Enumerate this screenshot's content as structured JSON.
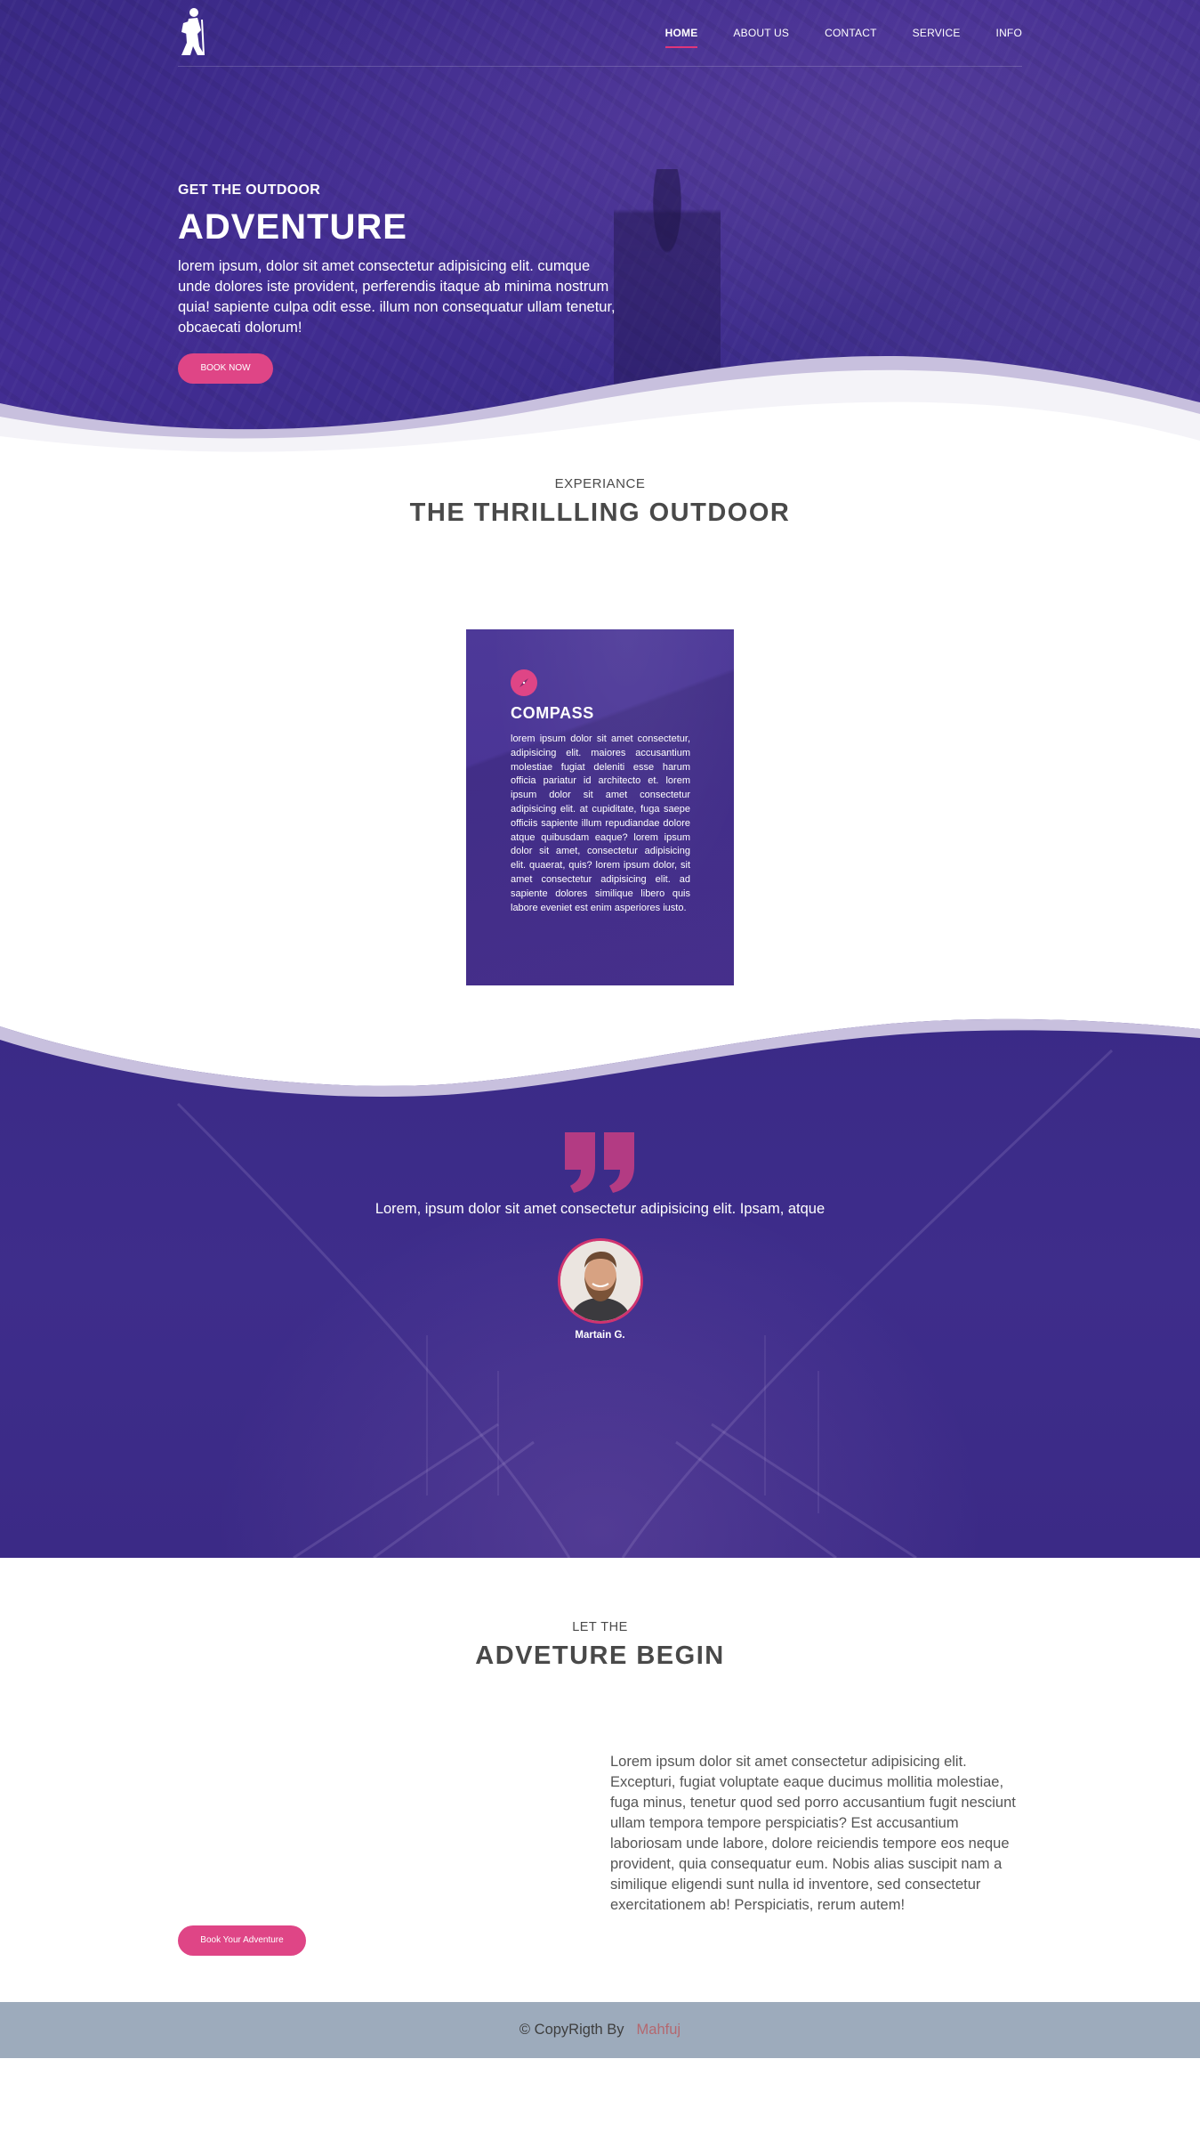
{
  "nav": {
    "items": [
      {
        "label": "HOME",
        "active": true
      },
      {
        "label": "ABOUT US",
        "active": false
      },
      {
        "label": "CONTACT",
        "active": false
      },
      {
        "label": "SERVICE",
        "active": false
      },
      {
        "label": "INFO",
        "active": false
      }
    ],
    "logo_icon": "hiker-icon"
  },
  "hero": {
    "kicker": "GET THE OUTDOOR",
    "title": "ADVENTURE",
    "description": "lorem ipsum, dolor sit amet consectetur adipisicing elit. cumque unde dolores iste provident, perferendis itaque ab minima nostrum quia! sapiente culpa odit esse. illum non consequatur ullam tenetur, obcaecati dolorum!",
    "button_label": "BOOK NOW"
  },
  "experience": {
    "kicker": "EXPERIANCE",
    "title": "THE THRILLLING OUTDOOR",
    "card": {
      "icon": "compass-icon",
      "title": "COMPASS",
      "text": "lorem ipsum dolor sit amet consectetur, adipisicing elit. maiores accusantium molestiae fugiat deleniti esse harum officia pariatur id architecto et. lorem ipsum dolor sit amet consectetur adipisicing elit. at cupiditate, fuga saepe officiis sapiente illum repudiandae dolore atque quibusdam eaque? lorem ipsum dolor sit amet, consectetur adipisicing elit. quaerat, quis? lorem ipsum dolor, sit amet consectetur adipisicing elit. ad sapiente dolores similique libero quis labore eveniet est enim asperiores iusto."
    }
  },
  "testimonial": {
    "quote_icon": "quote-icon",
    "quote": "Lorem, ipsum dolor sit amet consectetur adipisicing elit. Ipsam, atque",
    "author": "Martain G."
  },
  "adventure": {
    "kicker": "LET THE",
    "title": "ADVETURE BEGIN",
    "text": "Lorem ipsum dolor sit amet consectetur adipisicing elit. Excepturi, fugiat voluptate eaque ducimus mollitia molestiae, fuga minus, tenetur quod sed porro accusantium fugit nesciunt ullam tempora tempore perspiciatis? Est accusantium laboriosam unde labore, dolore reiciendis tempore eos neque provident, quia consequatur eum. Nobis alias suscipit nam a similique eligendi sunt nulla id inventore, sed consectetur exercitationem ab! Perspiciatis, rerum autem!",
    "button_label": "Book Your Adventure"
  },
  "footer": {
    "prefix": "© CopyRigth By",
    "author": "Mahfuj"
  },
  "colors": {
    "primary_purple": "#432d93",
    "accent_pink": "#df4586",
    "footer_bg": "#9dabbc",
    "footer_author": "#b4686f"
  }
}
